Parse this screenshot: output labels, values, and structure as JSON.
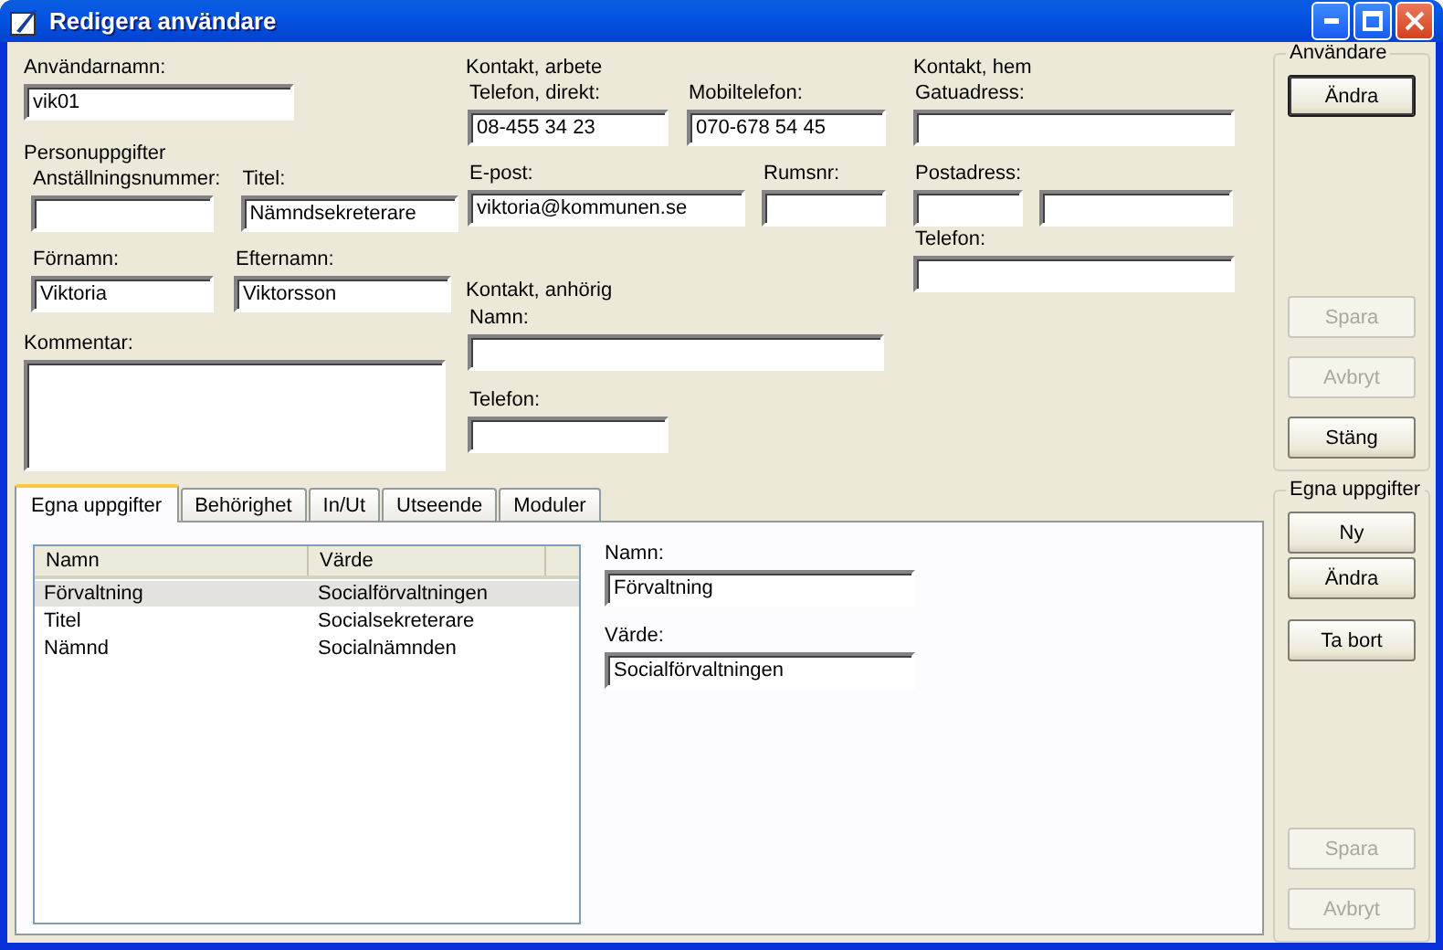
{
  "window": {
    "title": "Redigera användare"
  },
  "username": {
    "label": "Användarnamn:",
    "value": "vik01"
  },
  "personal": {
    "heading": "Personuppgifter",
    "fields": [
      {
        "label": "Anställningsnummer:"
      },
      {
        "label": "Titel:",
        "value": "Nämndsekreterare"
      },
      {
        "label": "Förnamn:",
        "value": "Viktoria"
      },
      {
        "label": "Efternamn:",
        "value": "Viktorsson"
      }
    ]
  },
  "comment": {
    "label": "Kommentar:"
  },
  "work_contact": {
    "heading": "Kontakt, arbete",
    "fields": [
      {
        "label": "Telefon, direkt:",
        "value": "08-455 34 23"
      },
      {
        "label": "Mobiltelefon:",
        "value": "070-678 54 45"
      },
      {
        "label": "E-post:",
        "value": "viktoria@kommunen.se"
      },
      {
        "label": "Rumsnr:"
      }
    ]
  },
  "relative_contact": {
    "heading": "Kontakt, anhörig",
    "fields": [
      {
        "label": "Namn:"
      },
      {
        "label": "Telefon:"
      }
    ]
  },
  "home_contact": {
    "heading": "Kontakt, hem",
    "fields": [
      {
        "kind": "labeled",
        "label": "Gatuadress:"
      },
      {
        "kind": "labeled",
        "label": "Postadress:"
      },
      {
        "kind": "unlabeled"
      },
      {
        "kind": "labeled",
        "label": "Telefon:"
      }
    ]
  },
  "tabs": [
    {
      "label": "Egna uppgifter",
      "selected": true
    },
    {
      "label": "Behörighet",
      "selected": false
    },
    {
      "label": "In/Ut",
      "selected": false
    },
    {
      "label": "Utseende",
      "selected": false
    },
    {
      "label": "Moduler",
      "selected": false
    }
  ],
  "properties": {
    "columns": [
      "Namn",
      "Värde"
    ],
    "rows": [
      {
        "cells": [
          "Förvaltning",
          "Socialförvaltningen"
        ],
        "selected": true
      },
      {
        "cells": [
          "Titel",
          "Socialsekreterare"
        ],
        "selected": false
      },
      {
        "cells": [
          "Nämnd",
          "Socialnämnden"
        ],
        "selected": false
      }
    ]
  },
  "detail": {
    "fields": [
      {
        "label": "Namn:",
        "value": "Förvaltning"
      },
      {
        "label": "Värde:",
        "value": "Socialförvaltningen"
      }
    ]
  },
  "side_groups": [
    {
      "title": "Användare",
      "top_buttons": [
        {
          "label": "Ändra",
          "default": true,
          "disabled": false
        }
      ],
      "bottom_buttons": [
        {
          "label": "Spara",
          "default": false,
          "disabled": true
        },
        {
          "label": "Avbryt",
          "default": false,
          "disabled": true
        },
        {
          "label": "Stäng",
          "default": false,
          "disabled": false
        }
      ]
    },
    {
      "title": "Egna uppgifter",
      "top_buttons": [
        {
          "label": "Ny",
          "default": false,
          "disabled": false
        },
        {
          "label": "Ändra",
          "default": false,
          "disabled": false
        },
        {
          "label": "Ta bort",
          "default": false,
          "disabled": false
        }
      ],
      "bottom_buttons": [
        {
          "label": "Spara",
          "default": false,
          "disabled": true
        },
        {
          "label": "Avbryt",
          "default": false,
          "disabled": true
        }
      ]
    }
  ]
}
